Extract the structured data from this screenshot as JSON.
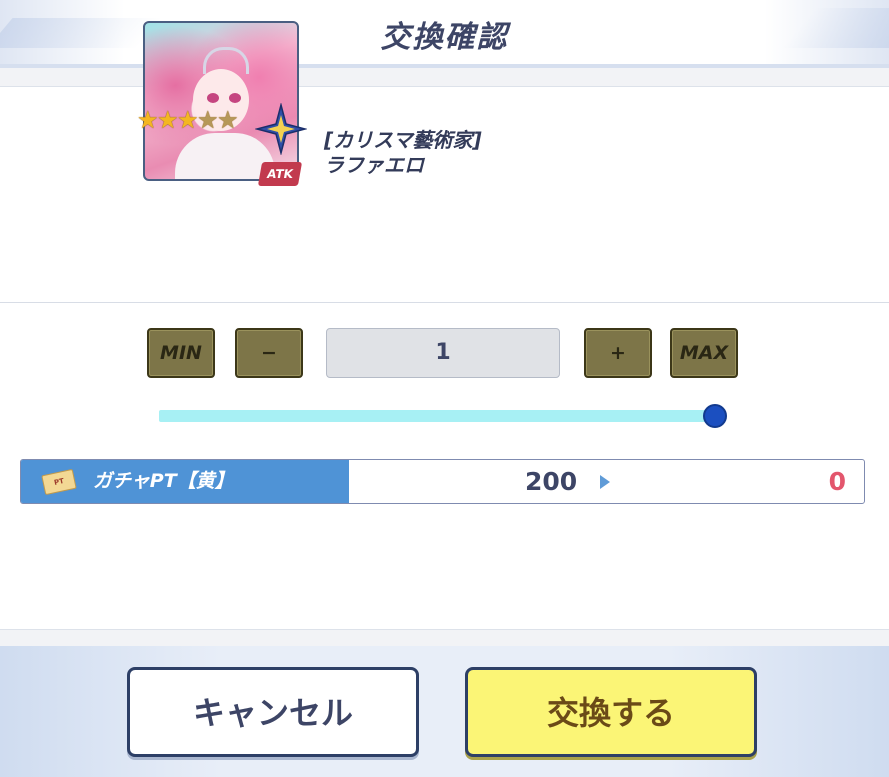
{
  "header": {
    "title": "交換確認"
  },
  "item": {
    "name_line1": "[カリスマ藝術家]",
    "name_line2": "ラファエロ",
    "stars_filled": 3,
    "stars_total": 5,
    "badge": "ATK"
  },
  "quantity": {
    "min_label": "MIN",
    "minus_label": "−",
    "value": "1",
    "plus_label": "+",
    "max_label": "MAX",
    "slider_level": 1.0
  },
  "currency": {
    "icon": "ticket-icon",
    "ticket_text": "PT",
    "name": "ガチャPT【黄】",
    "current": "200",
    "after": "0"
  },
  "footer": {
    "cancel_label": "キャンセル",
    "confirm_label": "交換する"
  },
  "colors": {
    "title": "#3d4566",
    "button_olive": "#7d7548",
    "slider_track": "#a7f0f4",
    "slider_knob": "#1b4fc0",
    "currency_label_bg": "#4f93d6",
    "after_value": "#e3566d",
    "confirm_bg": "#fbf576"
  }
}
